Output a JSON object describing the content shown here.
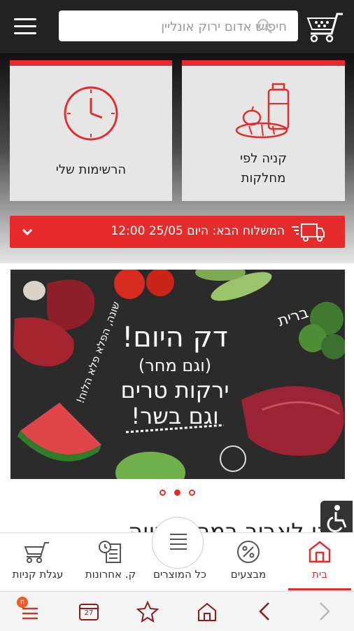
{
  "header": {
    "search_placeholder": "חיפוש אדום ירוק אונליין"
  },
  "tiles": {
    "my_lists": "הרשימות שלי",
    "by_department_line1": "קניה לפי",
    "by_department_line2": "מחלקות"
  },
  "delivery": {
    "text": "המשלוח הבא: היום 25/05 12:00"
  },
  "banner": {
    "line1": "דק היום!",
    "line2": "(וגם מחר)",
    "line3": "ירקות טרים",
    "line4": "וגם בשר!",
    "side_left": "שונה, הפלא פלא הלוח!",
    "side_right": "ברית"
  },
  "carousel": {
    "total": 3,
    "active": 1
  },
  "promo_heading": "באנו לאביב במחיר שווה",
  "bottom_nav": {
    "home": "בית",
    "deals": "מבצעים",
    "all_products": "כל המוצרים",
    "recent_purchases": "ק. אחרונות",
    "cart": "עגלת קניות"
  },
  "browser_bar": {
    "tabs_badge": "n",
    "calendar_day": "27"
  },
  "colors": {
    "accent": "#e52b2b",
    "dark": "#222222"
  }
}
